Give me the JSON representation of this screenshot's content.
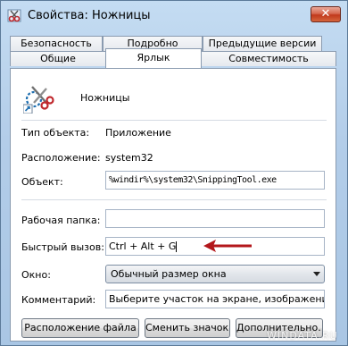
{
  "window": {
    "title": "Свойства: Ножницы",
    "close_label": "✕"
  },
  "tabs_row_top": [
    {
      "label": "Безопасность"
    },
    {
      "label": "Подробно"
    },
    {
      "label": "Предыдущие версии"
    }
  ],
  "tabs_row_bottom": [
    {
      "label": "Общие"
    },
    {
      "label": "Ярлык"
    },
    {
      "label": "Совместимость"
    }
  ],
  "active_tab": "Ярлык",
  "shortcut": {
    "name": "Ножницы",
    "type_label": "Тип объекта:",
    "type_value": "Приложение",
    "location_label": "Расположение:",
    "location_value": "system32",
    "target_label": "Объект:",
    "target_value": "%windir%\\system32\\SnippingTool.exe",
    "workdir_label": "Рабочая папка:",
    "workdir_value": "",
    "hotkey_label": "Быстрый вызов:",
    "hotkey_value": "Ctrl + Alt + G",
    "window_label": "Окно:",
    "window_value": "Обычный размер окна",
    "comment_label": "Комментарий:",
    "comment_value": "Выберите участок на экране, изображение кот"
  },
  "buttons": {
    "file_location": "Расположение файла",
    "change_icon": "Сменить значок...",
    "advanced": "Дополнительно..."
  },
  "colors": {
    "arrow": "#b3171b",
    "close_button": "#c8442a"
  },
  "watermark": "WINDATA.RU"
}
